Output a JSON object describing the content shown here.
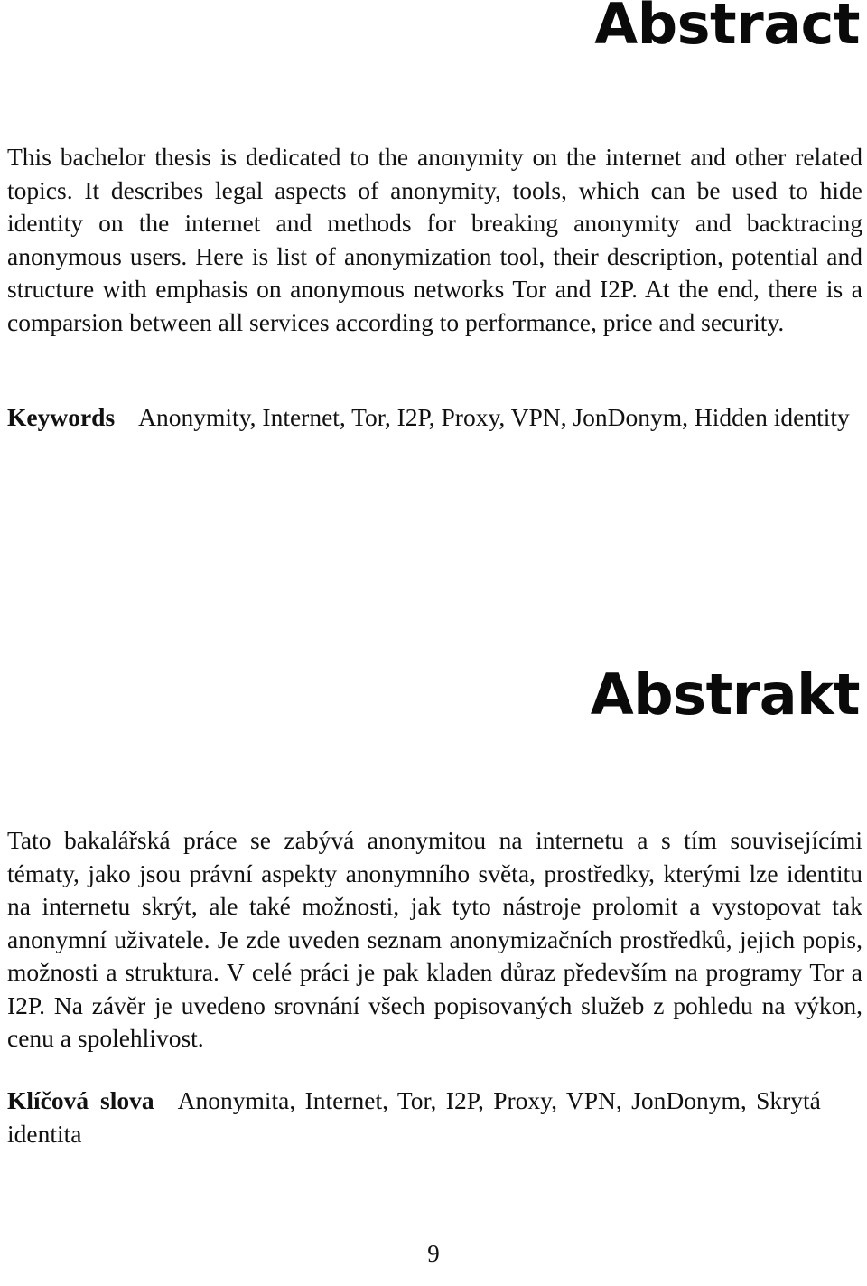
{
  "page": {
    "number": "9",
    "language_sections": [
      "english",
      "czech"
    ]
  },
  "english": {
    "heading": "Abstract",
    "paragraph": "This bachelor thesis is dedicated to the anonymity on the internet and other related topics. It describes legal aspects of anonymity, tools, which can be used to hide identity on the internet and methods for breaking anonymity and backtracing anonymous users. Here is list of anonymization tool, their description, potential and structure with emphasis on anonymous networks Tor and I2P. At the end, there is a comparsion between all services according to performance, price and security.",
    "keywords_label": "Keywords",
    "keywords_value": "Anonymity, Internet, Tor, I2P, Proxy, VPN, JonDonym, Hidden identity",
    "keywords_list": [
      "Anonymity",
      "Internet",
      "Tor",
      "I2P",
      "Proxy",
      "VPN",
      "JonDonym",
      "Hidden identity"
    ]
  },
  "czech": {
    "heading": "Abstrakt",
    "paragraph": "Tato bakalářská práce se zabývá anonymitou na internetu a s tím souvisejícími tématy, jako jsou právní aspekty anonymního světa, prostředky, kterými lze identitu na internetu skrýt, ale také možnosti, jak tyto nástroje prolomit a vystopovat tak anonymní uživatele. Je zde uveden seznam anonymizačních prostředků, jejich popis, možnosti a struktura. V celé práci je pak kladen důraz především na programy Tor a I2P. Na závěr je uvedeno srovnání všech popisovaných služeb z pohledu na výkon, cenu a spolehlivost.",
    "keywords_label": "Klíčová slova",
    "keywords_value": "Anonymita, Internet, Tor, I2P, Proxy, VPN, JonDonym, Skrytá identita",
    "keywords_list": [
      "Anonymita",
      "Internet",
      "Tor",
      "I2P",
      "Proxy",
      "VPN",
      "JonDonym",
      "Skrytá identita"
    ]
  },
  "colors": {
    "text": "#111111",
    "heading": "#0a0a0a",
    "background": "#ffffff"
  }
}
